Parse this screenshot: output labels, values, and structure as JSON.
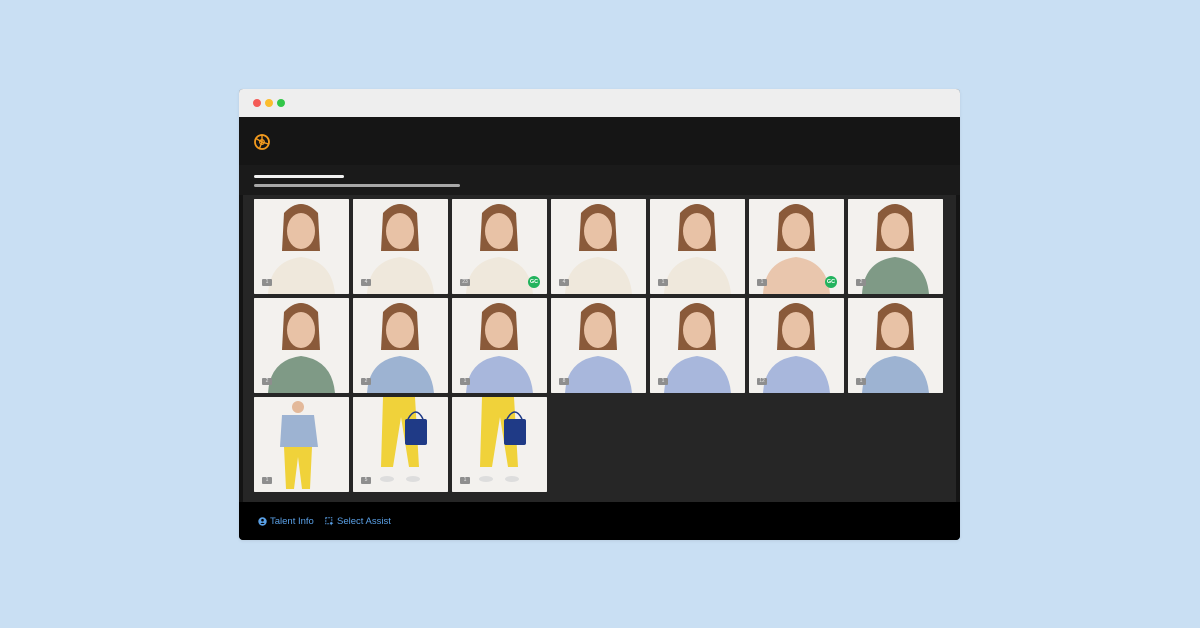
{
  "app": {
    "accent_color": "#f29a1e",
    "logo_icon": "aperture-logo-icon"
  },
  "grid": {
    "thumbnails": [
      {
        "comment": "1",
        "badge": "",
        "outfit": "cream-sweater"
      },
      {
        "comment": "4",
        "badge": "",
        "outfit": "cream-sweater"
      },
      {
        "comment": "23",
        "badge": "GC",
        "outfit": "cream-sweater"
      },
      {
        "comment": "4",
        "badge": "",
        "outfit": "cream-sweater"
      },
      {
        "comment": "1",
        "badge": "",
        "outfit": "cream-sweater"
      },
      {
        "comment": "1",
        "badge": "GC",
        "outfit": "bare-shoulders"
      },
      {
        "comment": "2",
        "badge": "",
        "outfit": "green-scarf"
      },
      {
        "comment": "2",
        "badge": "",
        "outfit": "green-scarf"
      },
      {
        "comment": "2",
        "badge": "",
        "outfit": "blue-sweater"
      },
      {
        "comment": "1",
        "badge": "",
        "outfit": "striped-shirt"
      },
      {
        "comment": "8",
        "badge": "",
        "outfit": "striped-shirt"
      },
      {
        "comment": "1",
        "badge": "",
        "outfit": "striped-shirt"
      },
      {
        "comment": "12",
        "badge": "",
        "outfit": "striped-shirt"
      },
      {
        "comment": "1",
        "badge": "",
        "outfit": "blue-sweater"
      },
      {
        "comment": "1",
        "badge": "",
        "outfit": "blue-sweater-yellow-pants"
      },
      {
        "comment": "5",
        "badge": "",
        "outfit": "yellow-pants-bag"
      },
      {
        "comment": "1",
        "badge": "",
        "outfit": "yellow-pants-bag"
      }
    ]
  },
  "footer": {
    "talent_info_label": "Talent Info",
    "talent_info_icon": "person-info-icon",
    "select_assist_label": "Select Assist",
    "select_assist_icon": "select-assist-icon"
  }
}
